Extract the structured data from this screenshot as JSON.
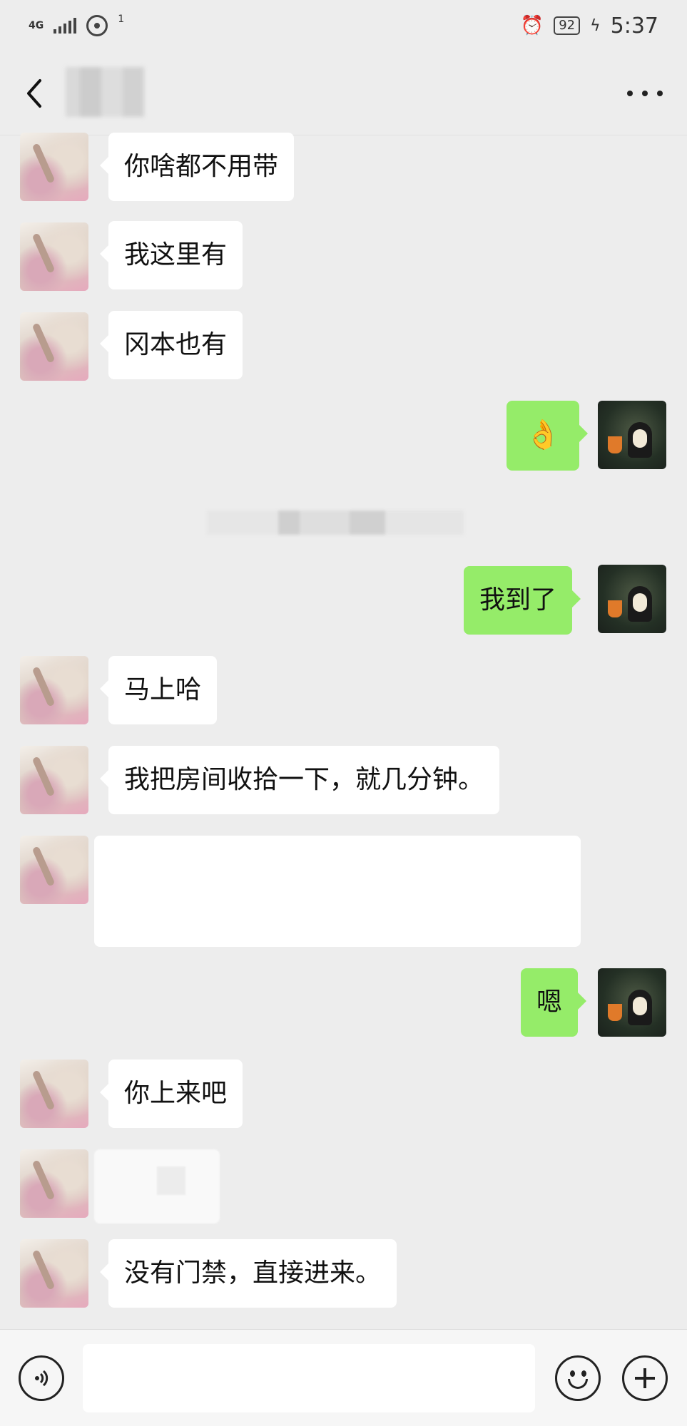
{
  "status_bar": {
    "network": "4G",
    "hotspot_count": "1",
    "battery": "92",
    "time": "5:37"
  },
  "header": {
    "contact_name": ""
  },
  "messages": [
    {
      "sender": "contact",
      "text": "你啥都不用带"
    },
    {
      "sender": "contact",
      "text": "我这里有"
    },
    {
      "sender": "contact",
      "text": "冈本也有"
    },
    {
      "sender": "me",
      "text": "👌"
    },
    {
      "sender": "me",
      "text": "我到了"
    },
    {
      "sender": "contact",
      "text": "马上哈"
    },
    {
      "sender": "contact",
      "text": "我把房间收拾一下，就几分钟。"
    },
    {
      "sender": "contact",
      "text": ""
    },
    {
      "sender": "me",
      "text": "嗯"
    },
    {
      "sender": "contact",
      "text": "你上来吧"
    },
    {
      "sender": "contact",
      "text": ""
    },
    {
      "sender": "contact",
      "text": "没有门禁，直接进来。"
    }
  ],
  "input_bar": {
    "placeholder": "",
    "value": ""
  },
  "colors": {
    "background": "#ededed",
    "incoming_bubble": "#ffffff",
    "outgoing_bubble": "#95ec69"
  }
}
